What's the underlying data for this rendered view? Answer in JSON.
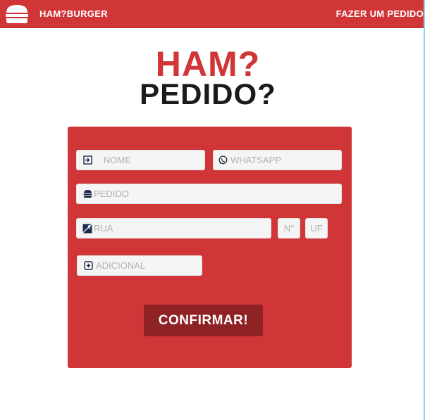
{
  "navbar": {
    "brand": "HAM?BURGER",
    "order_link": "FAZER UM PEDIDO"
  },
  "heading": {
    "line1": "HAM?",
    "line2": "PEDIDO?"
  },
  "form": {
    "nome": {
      "placeholder": "NOME",
      "icon": "sign-in-icon"
    },
    "whatsapp": {
      "placeholder": "WHATSAPP",
      "icon": "whatsapp-icon"
    },
    "pedido": {
      "placeholder": "PEDIDO",
      "icon": "burger-icon"
    },
    "rua": {
      "placeholder": "RUA",
      "icon": "map-icon"
    },
    "numero": {
      "placeholder": "N°"
    },
    "uf": {
      "placeholder": "UF"
    },
    "adicional": {
      "placeholder": "ADICIONAL",
      "icon": "plus-square-icon"
    },
    "confirm_label": "CONFIRMAR!"
  },
  "colors": {
    "brand_red": "#d03537",
    "button_dark_red": "#8e2225",
    "heading_dark": "#1b1b1b"
  }
}
